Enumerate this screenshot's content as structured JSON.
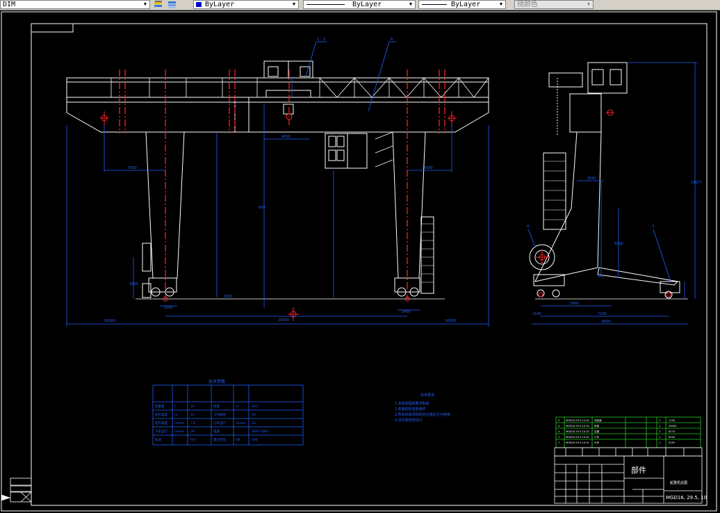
{
  "toolbar": {
    "layer_name": "DIM",
    "color_value": "ByLayer",
    "linetype_value": "ByLayer",
    "lineweight_value": "ByLayer",
    "plotstyle_value": "随颜色",
    "accent_color": "#0000cc"
  },
  "drawing": {
    "front_view": {
      "callouts": [
        "1",
        "2",
        "4"
      ],
      "dimensions": [
        "7500",
        "5000",
        "26000",
        "29500",
        "16500",
        "2000",
        "1500",
        "4000",
        "2400",
        "3500",
        "800"
      ]
    },
    "side_view": {
      "callouts": [
        "4",
        "3"
      ],
      "dimensions": [
        "14677",
        "4540",
        "6500",
        "5400",
        "7300",
        "500",
        "9600",
        "2100"
      ]
    },
    "parameter_table": {
      "title": "技术参数",
      "rows": [
        [
          "起重量",
          "t",
          "16",
          "跨度",
          "m",
          "29.5"
        ],
        [
          "起升高度",
          "m",
          "10",
          "工作级别",
          "",
          "A5"
        ],
        [
          "起升速度",
          "m/min",
          "7.6",
          "小车运行",
          "m/min",
          "20"
        ],
        [
          "大车运行",
          "m/min",
          "30",
          "电源",
          "",
          "380V 50Hz"
        ],
        [
          "轨道",
          "",
          "P43",
          "最大轮压",
          "kN",
          "190"
        ]
      ]
    },
    "tech_notes": {
      "title": "技术要求",
      "lines": [
        "1.本机按图纸要求制造",
        "2.安装前检查各部件",
        "3.所有焊缝须经检验合格后方可使用",
        "4.试车按规范进行"
      ]
    },
    "title_block": {
      "part_label": "部件",
      "drawing_name": "起重机总图",
      "drawing_number": "MGD16, 29.5, 10",
      "parts": [
        [
          "5",
          "MGD16.29.5.10.05",
          "司机室",
          "",
          "1",
          "1150"
        ],
        [
          "4",
          "MGD16.29.5.10.04",
          "桥架",
          "",
          "1",
          "26045"
        ],
        [
          "3",
          "MGD16.29.5.10.03",
          "支腿",
          "",
          "1",
          "8270"
        ],
        [
          "2",
          "MGD16.29.5.10.02",
          "小车",
          "",
          "1",
          "6200"
        ],
        [
          "1",
          "MGD16.29.5.10.01",
          "大车",
          "",
          "1",
          "3050"
        ]
      ]
    }
  }
}
